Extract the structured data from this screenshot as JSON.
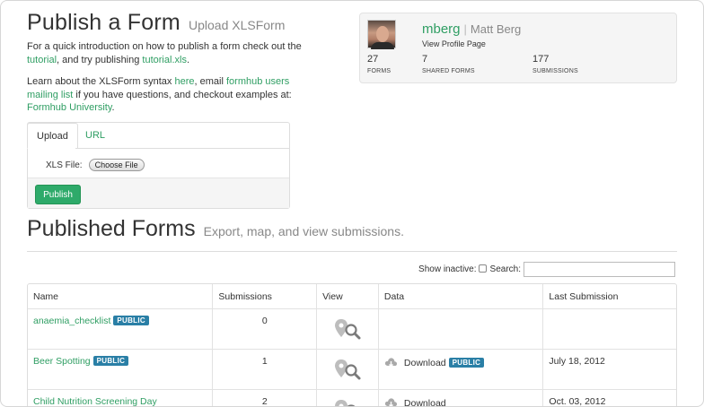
{
  "header": {
    "title": "Publish a Form",
    "subtitle": "Upload XLSForm",
    "intro1_pre": "For a quick introduction on how to publish a form check out the ",
    "intro1_link1": "tutorial",
    "intro1_mid": ", and try publishing ",
    "intro1_link2": "tutorial.xls",
    "intro1_post": ".",
    "intro2_pre": "Learn about the XLSForm syntax ",
    "intro2_link1": "here",
    "intro2_mid": ", email ",
    "intro2_link2": "formhub users mailing list",
    "intro2_mid2": " if you have questions, and checkout examples at: ",
    "intro2_link3": "Formhub University",
    "intro2_post": "."
  },
  "profile": {
    "username": "mberg",
    "separator": "|",
    "full_name": "Matt Berg",
    "view_profile": "View Profile Page",
    "stats": [
      {
        "value": "27",
        "label": "FORMS"
      },
      {
        "value": "7",
        "label": "SHARED FORMS"
      },
      {
        "value": "177",
        "label": "SUBMISSIONS"
      }
    ]
  },
  "upload": {
    "tab_upload": "Upload",
    "tab_url": "URL",
    "file_label": "XLS File:",
    "choose_file": "Choose File",
    "publish": "Publish"
  },
  "published": {
    "title": "Published Forms",
    "subtitle": "Export, map, and view submissions.",
    "show_inactive": "Show inactive:",
    "search_label": "Search:",
    "columns": [
      "Name",
      "Submissions",
      "View",
      "Data",
      "Last Submission"
    ],
    "rows": [
      {
        "name": "anaemia_checklist",
        "badge": "PUBLIC",
        "submissions": "0",
        "data_label": "",
        "data_badge": "",
        "last": ""
      },
      {
        "name": "Beer Spotting",
        "badge": "PUBLIC",
        "submissions": "1",
        "data_label": "Download",
        "data_badge": "PUBLIC",
        "last": "July 18, 2012"
      },
      {
        "name": "Child Nutrition Screening Day",
        "badge": "",
        "submissions": "2",
        "data_label": "Download",
        "data_badge": "",
        "last": "Oct. 03, 2012"
      }
    ]
  },
  "colors": {
    "accent": "#2f9e63",
    "badge": "#2a7fa6",
    "button": "#2eaa6a"
  },
  "icons": {
    "view": "map-search-icon",
    "download": "cloud-download-icon"
  }
}
